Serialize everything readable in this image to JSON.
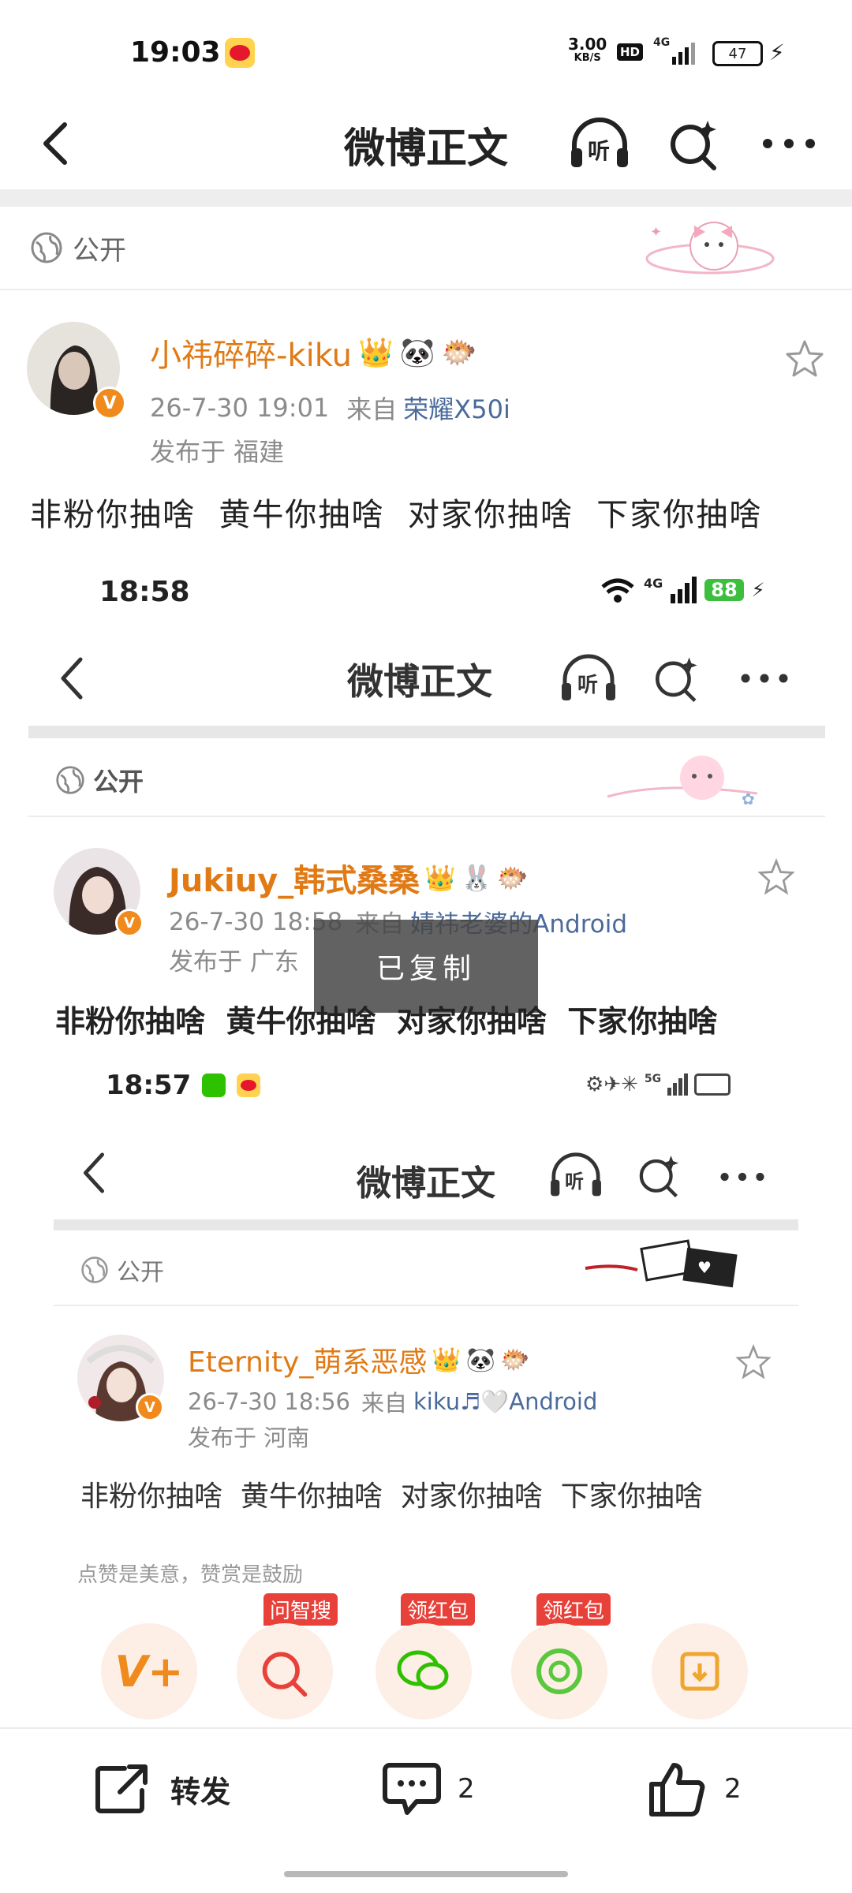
{
  "statusbar": {
    "time": "19:03",
    "net_speed_top": "3.00",
    "net_speed_bottom": "KB/S",
    "hd": "HD",
    "net_type": "4G",
    "battery": "47"
  },
  "nav": {
    "title": "微博正文",
    "listen_label": "听"
  },
  "post": {
    "visibility": "公开",
    "username": "小祎碎碎-kiku",
    "time": "26-7-30 19:01",
    "from_label": "来自",
    "device": "荣耀X50i",
    "location": "发布于 福建",
    "text": "非粉你抽啥  黄牛你抽啥  对家你抽啥  下家你抽啥"
  },
  "shot1": {
    "time": "18:58",
    "net_type": "4G",
    "battery": "88",
    "title": "微博正文",
    "listen_label": "听",
    "visibility": "公开",
    "username": "Jukiuy_韩式桑桑",
    "time_line": "26-7-30 18:58",
    "from_label": "来自",
    "device": "婧祎老婆的Android",
    "location": "发布于 广东",
    "text": "非粉你抽啥  黄牛你抽啥  对家你抽啥  下家你抽啥",
    "toast": "已复制"
  },
  "shot2": {
    "time": "18:57",
    "net_type": "5G",
    "title": "微博正文",
    "listen_label": "听",
    "visibility": "公开",
    "username": "Eternity_萌系恶感",
    "time_line": "26-7-30 18:56",
    "from_label": "来自",
    "device": "kiku♬🤍Android",
    "location": "发布于 河南",
    "text": "非粉你抽啥  黄牛你抽啥  对家你抽啥  下家你抽啥",
    "reward_hint": "点赞是美意，赞赏是鼓励",
    "tags": [
      "问智搜",
      "领红包",
      "领红包"
    ]
  },
  "bottom": {
    "repost_label": "转发",
    "comment_count": "2",
    "like_count": "2"
  },
  "colors": {
    "orange": "#e07a15",
    "link": "#4a6a9b",
    "green_battery": "#3cbf3c",
    "red": "#e8413a"
  }
}
